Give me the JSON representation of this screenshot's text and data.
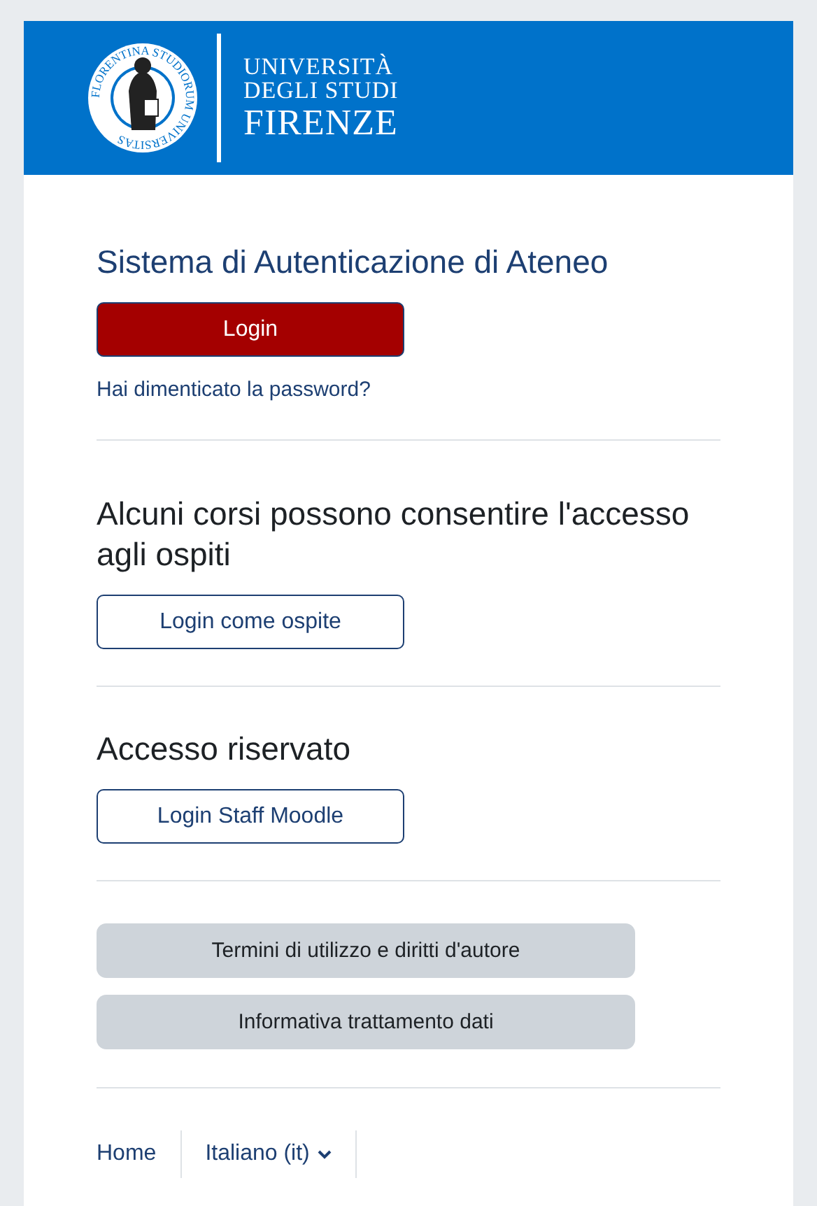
{
  "header": {
    "seal_text": "FLORENTINA STUDIORUM UNIVERSITAS",
    "wordmark": [
      "UNIVERSITÀ",
      "DEGLI STUDI",
      "FIRENZE"
    ]
  },
  "sections": [
    {
      "heading": "Sistema di Autenticazione di Ateneo",
      "kind": "primary",
      "button": "Login",
      "link": "Hai dimenticato la password?"
    },
    {
      "heading": "Alcuni corsi possono consentire l'accesso agli ospiti",
      "kind": "outline",
      "button": "Login come ospite"
    },
    {
      "heading": "Accesso riservato",
      "kind": "outline",
      "button": "Login Staff Moodle"
    }
  ],
  "policy_buttons": [
    "Termini di utilizzo e diritti d'autore",
    "Informativa trattamento dati"
  ],
  "footer": {
    "home": "Home",
    "language": "Italiano (it)"
  }
}
